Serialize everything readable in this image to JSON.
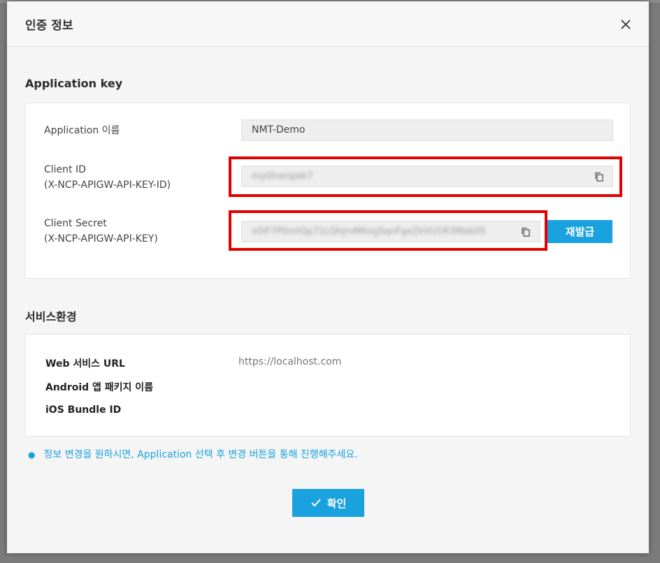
{
  "modal": {
    "title": "인증 정보"
  },
  "application_key": {
    "section_title": "Application key",
    "app_name_label": "Application 이름",
    "app_name_value": "NMT-Demo",
    "client_id_label_line1": "Client ID",
    "client_id_label_line2": "(X-NCP-APIGW-API-KEY-ID)",
    "client_id_value": "my0hwnpek7",
    "client_secret_label_line1": "Client Secret",
    "client_secret_label_line2": "(X-NCP-APIGW-API-KEY)",
    "client_secret_value": "x0iF7P0mtQp71LQhjmM6vgSqnFgeZkVU1R3Mab0S",
    "reissue_label": "재발급"
  },
  "service_env": {
    "section_title": "서비스환경",
    "web_url_label": "Web 서비스 URL",
    "web_url_value": "https://localhost.com",
    "android_label": "Android 앱 패키지 이름",
    "ios_label": "iOS Bundle ID"
  },
  "notice": {
    "text": "정보 변경을 원하시면, Application 선택 후 변경 버튼을 통해 진행해주세요."
  },
  "footer": {
    "confirm_label": "확인"
  },
  "colors": {
    "accent": "#1aa2df",
    "highlight_box": "#e30000"
  },
  "icons": [
    "close-icon",
    "copy-icon",
    "check-icon"
  ]
}
